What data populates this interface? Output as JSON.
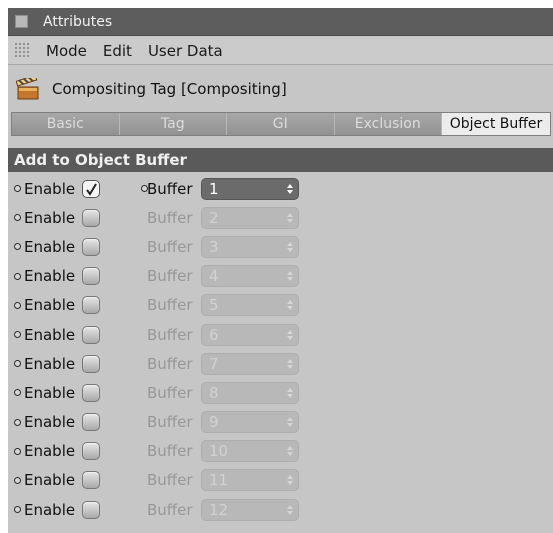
{
  "window": {
    "title": "Attributes"
  },
  "menu": [
    "Mode",
    "Edit",
    "User Data"
  ],
  "object": {
    "title": "Compositing Tag [Compositing]",
    "icon": "clapperboard-icon"
  },
  "tabs": [
    {
      "label": "Basic",
      "active": false
    },
    {
      "label": "Tag",
      "active": false
    },
    {
      "label": "GI",
      "active": false
    },
    {
      "label": "Exclusion",
      "active": false
    },
    {
      "label": "Object Buffer",
      "active": true
    }
  ],
  "section": {
    "title": "Add to Object Buffer"
  },
  "rows": [
    {
      "enable_label": "Enable",
      "checked": true,
      "buffer_label": "Buffer",
      "value": "1"
    },
    {
      "enable_label": "Enable",
      "checked": false,
      "buffer_label": "Buffer",
      "value": "2"
    },
    {
      "enable_label": "Enable",
      "checked": false,
      "buffer_label": "Buffer",
      "value": "3"
    },
    {
      "enable_label": "Enable",
      "checked": false,
      "buffer_label": "Buffer",
      "value": "4"
    },
    {
      "enable_label": "Enable",
      "checked": false,
      "buffer_label": "Buffer",
      "value": "5"
    },
    {
      "enable_label": "Enable",
      "checked": false,
      "buffer_label": "Buffer",
      "value": "6"
    },
    {
      "enable_label": "Enable",
      "checked": false,
      "buffer_label": "Buffer",
      "value": "7"
    },
    {
      "enable_label": "Enable",
      "checked": false,
      "buffer_label": "Buffer",
      "value": "8"
    },
    {
      "enable_label": "Enable",
      "checked": false,
      "buffer_label": "Buffer",
      "value": "9"
    },
    {
      "enable_label": "Enable",
      "checked": false,
      "buffer_label": "Buffer",
      "value": "10"
    },
    {
      "enable_label": "Enable",
      "checked": false,
      "buffer_label": "Buffer",
      "value": "11"
    },
    {
      "enable_label": "Enable",
      "checked": false,
      "buffer_label": "Buffer",
      "value": "12"
    }
  ]
}
